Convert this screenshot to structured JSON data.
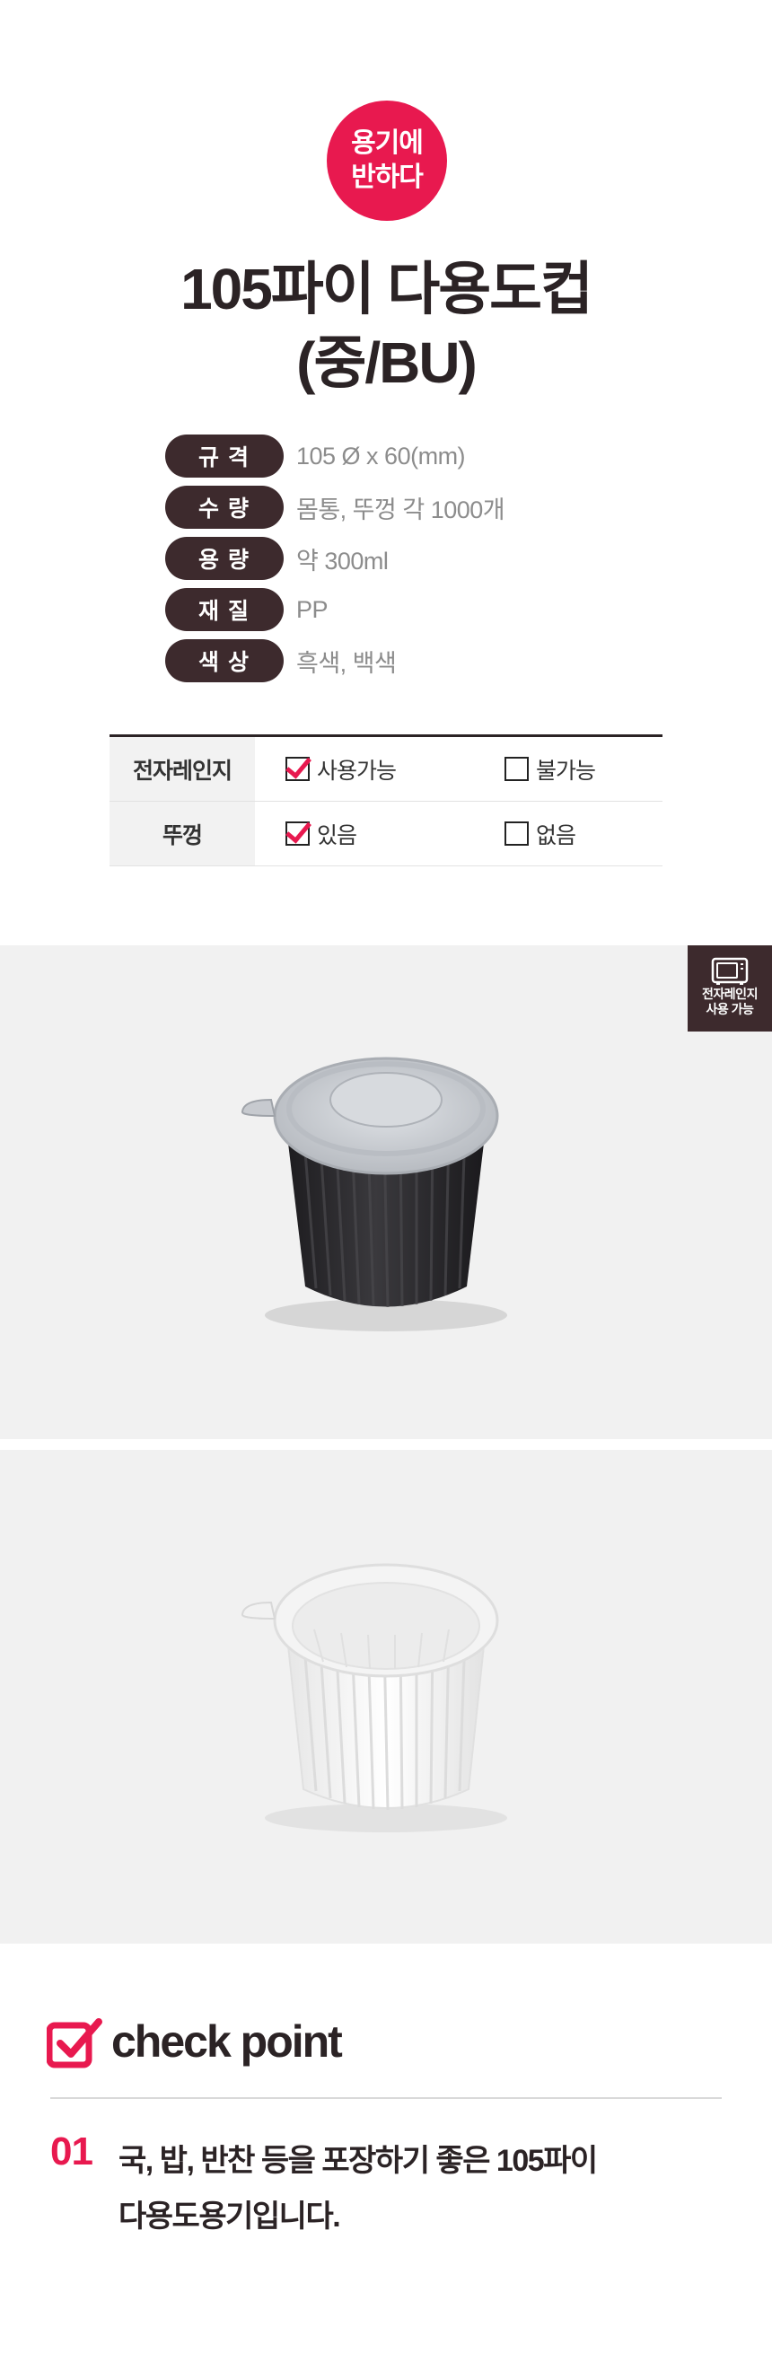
{
  "badge": {
    "line1": "용기에",
    "line2": "반하다"
  },
  "title": {
    "line1": "105파이 다용도컵",
    "line2": "(중/BU)"
  },
  "spec": [
    {
      "key": "규격",
      "value": "105 Ø x 60(mm)"
    },
    {
      "key": "수량",
      "value": "몸통, 뚜껑 각 1000개"
    },
    {
      "key": "용량",
      "value": "약 300ml"
    },
    {
      "key": "재질",
      "value": "PP"
    },
    {
      "key": "색상",
      "value": "흑색, 백색"
    }
  ],
  "options": [
    {
      "header": "전자레인지",
      "a_label": "사용가능",
      "a_checked": true,
      "b_label": "불가능",
      "b_checked": false
    },
    {
      "header": "뚜껑",
      "a_label": "있음",
      "a_checked": true,
      "b_label": "없음",
      "b_checked": false
    }
  ],
  "photos": {
    "microwave_badge": {
      "line1": "전자레인지",
      "line2": "사용 가능",
      "icon": "microwave-icon"
    },
    "black_cup": {
      "body_color": "#2a292c",
      "lid_color": "#c9ccd0"
    },
    "white_cup": {
      "body_color": "#f8f8f8",
      "lid_color": "#ebebeb"
    }
  },
  "checkpoint": {
    "title": "check point",
    "number": "01",
    "line1": "국, 밥, 반찬 등을 포장하기 좋은 105파이",
    "line2": "다용도용기입니다."
  },
  "colors": {
    "accent": "#e8194f",
    "dark": "#3d2a2d",
    "panel_bg": "#f1f1f1"
  }
}
